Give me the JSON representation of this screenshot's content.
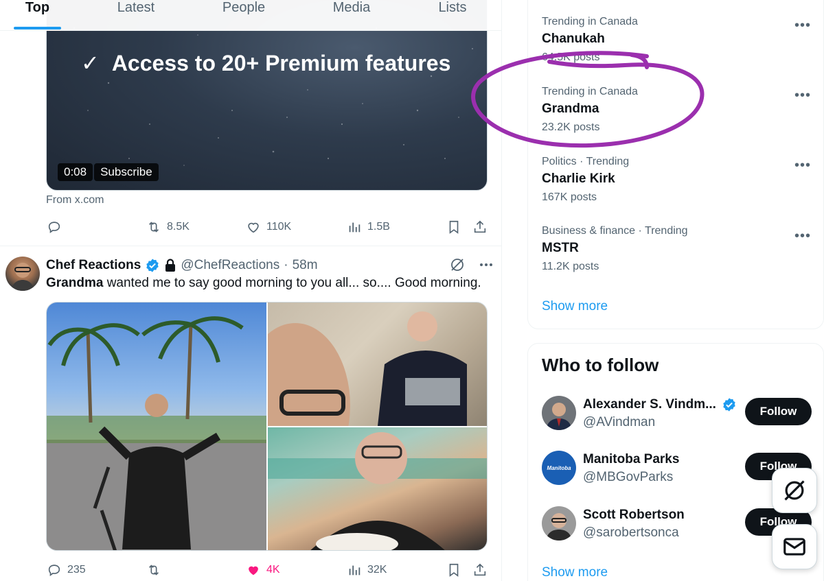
{
  "tabs": [
    {
      "label": "Top",
      "active": true
    },
    {
      "label": "Latest",
      "active": false
    },
    {
      "label": "People",
      "active": false
    },
    {
      "label": "Media",
      "active": false
    },
    {
      "label": "Lists",
      "active": false
    }
  ],
  "promo": {
    "feature_text": "Access to 20+ Premium features",
    "video_time": "0:08",
    "subscribe_label": "Subscribe",
    "source": "From x.com",
    "retweets": "8.5K",
    "likes": "110K",
    "views": "1.5B"
  },
  "tweet": {
    "name": "Chef Reactions",
    "handle": "@ChefReactions",
    "separator": "·",
    "time": "58m",
    "text_bold": "Grandma",
    "text_rest": " wanted me to say good morning to you all... so.... Good morning.",
    "replies": "235",
    "likes": "4K",
    "views": "32K"
  },
  "trends": [
    {
      "meta": "Trending in Canada",
      "title": "Chanukah",
      "count": "64.5K posts"
    },
    {
      "meta": "Trending in Canada",
      "title": "Grandma",
      "count": "23.2K posts"
    },
    {
      "meta": "Politics · Trending",
      "title": "Charlie Kirk",
      "count": "167K posts"
    },
    {
      "meta": "Business & finance · Trending",
      "title": "MSTR",
      "count": "11.2K posts"
    }
  ],
  "trends_show_more": "Show more",
  "who_to_follow": {
    "title": "Who to follow",
    "people": [
      {
        "name": "Alexander S. Vindm...",
        "handle": "@AVindman",
        "verified": true,
        "follow_label": "Follow"
      },
      {
        "name": "Manitoba Parks",
        "handle": "@MBGovParks",
        "verified": false,
        "follow_label": "Follow",
        "avatar_text": "Manitoba"
      },
      {
        "name": "Scott Robertson",
        "handle": "@sarobertsonca",
        "verified": false,
        "follow_label": "Follow"
      }
    ],
    "show_more": "Show more"
  },
  "colors": {
    "accent": "#1d9bf0",
    "like": "#f91880",
    "annotation": "#9b2fae"
  },
  "icons": [
    "reply-icon",
    "retweet-icon",
    "like-icon",
    "views-icon",
    "bookmark-icon",
    "share-icon",
    "grok-icon",
    "more-icon",
    "verified-icon",
    "lock-icon",
    "messages-icon"
  ]
}
